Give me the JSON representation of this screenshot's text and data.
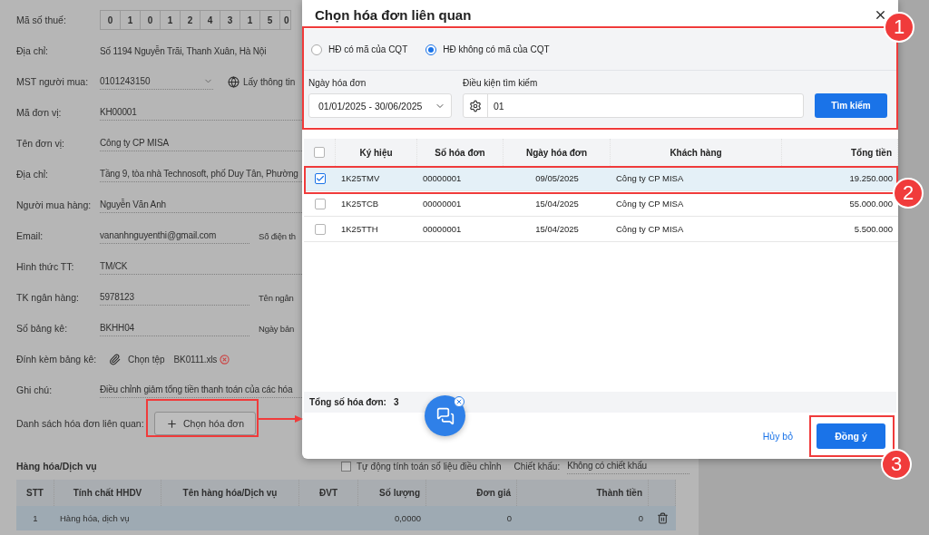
{
  "form": {
    "tax_code": {
      "label": "Mã số thuế:",
      "digits": [
        "0",
        "1",
        "0",
        "1",
        "2",
        "4",
        "3",
        "1",
        "5",
        "0"
      ]
    },
    "fields": [
      {
        "kind": "plain",
        "label": "Địa chỉ:",
        "value": "Số 1194 Nguyễn Trãi, Thanh Xuân, Hà Nội"
      },
      {
        "kind": "select",
        "label": "MST người mua:",
        "value": "0101243150",
        "link": "Lấy thông tin"
      },
      {
        "kind": "field",
        "label": "Mã đơn vị:",
        "value": "KH00001"
      },
      {
        "kind": "field",
        "label": "Tên đơn vị:",
        "value": "Công ty CP MISA"
      },
      {
        "kind": "field",
        "label": "Địa chỉ:",
        "value": "Tầng 9, tòa nhà Technosoft, phố Duy Tân, Phường"
      },
      {
        "kind": "field",
        "label": "Người mua hàng:",
        "value": "Nguyễn Văn Anh"
      },
      {
        "kind": "field",
        "label": "Email:",
        "value": "vananhnguyenthi@gmail.com",
        "side_label": "Số điện th"
      },
      {
        "kind": "field",
        "label": "Hình thức TT:",
        "value": "TM/CK"
      },
      {
        "kind": "field",
        "label": "TK ngân hàng:",
        "value": "5978123",
        "side_label": "Tên ngân"
      },
      {
        "kind": "field",
        "label": "Số bảng kê:",
        "value": "BKHH04",
        "side_label": "Ngày bản"
      },
      {
        "kind": "attach",
        "label": "Đính kèm bảng kê:",
        "value": "Chọn tệp",
        "file": "BK0111.xls"
      },
      {
        "kind": "field",
        "label": "Ghi chú:",
        "value": "Điều chỉnh giảm tổng tiền thanh toán của các hóa"
      },
      {
        "kind": "related",
        "label": "Danh sách hóa đơn liên quan:",
        "value": "Chọn hóa đơn"
      }
    ]
  },
  "goods": {
    "title": "Hàng hóa/Dịch vụ",
    "auto_calc": {
      "label": "Tự động tính toán số liệu điều chỉnh",
      "checked": false
    },
    "discount": {
      "label": "Chiết khấu:",
      "value": "Không có chiết khấu"
    },
    "columns": [
      "STT",
      "Tính chất HHDV",
      "Tên hàng hóa/Dịch vụ",
      "ĐVT",
      "Số lượng",
      "Đơn giá",
      "Thành tiền"
    ],
    "rows": [
      {
        "stt": "1",
        "nature": "Hàng hóa, dịch vụ",
        "quantity": "0,0000",
        "unit_price": "0",
        "amount": "0"
      }
    ]
  },
  "modal": {
    "title": "Chọn hóa đơn liên quan",
    "filter": {
      "options": [
        {
          "label": "HĐ có mã của CQT",
          "selected": false
        },
        {
          "label": "HĐ không có mã của CQT",
          "selected": true
        }
      ],
      "date_label": "Ngày hóa đơn",
      "date_value": "01/01/2025 - 30/06/2025",
      "condition_label": "Điều kiện tìm kiếm",
      "condition_value": "01",
      "search_button": "Tìm kiếm"
    },
    "all_selected": false,
    "columns": [
      "Ký hiệu",
      "Số hóa đơn",
      "Ngày hóa đơn",
      "Khách hàng",
      "Tổng tiền"
    ],
    "invoices": [
      {
        "symbol": "1K25TMV",
        "number": "00000001",
        "date": "09/05/2025",
        "customer": "Công ty CP MISA",
        "total": "19.250.000",
        "selected": true
      },
      {
        "symbol": "1K25TCB",
        "number": "00000001",
        "date": "15/04/2025",
        "customer": "Công ty CP MISA",
        "total": "55.000.000",
        "selected": false
      },
      {
        "symbol": "1K25TTH",
        "number": "00000001",
        "date": "15/04/2025",
        "customer": "Công ty CP MISA",
        "total": "5.500.000",
        "selected": false
      }
    ],
    "summary_label": "Tổng số hóa đơn:",
    "summary_count": "3",
    "cancel": "Hủy bỏ",
    "confirm": "Đồng ý"
  },
  "callouts": [
    "1",
    "2",
    "3"
  ]
}
